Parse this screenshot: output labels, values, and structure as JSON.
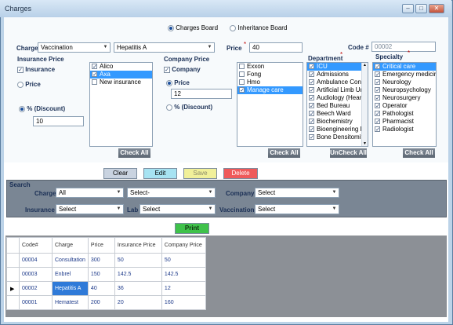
{
  "window": {
    "title": "Charges",
    "min": "–",
    "max": "□",
    "close": "✕"
  },
  "board": {
    "charges": "Charges Board",
    "inheritance": "Inheritance Board"
  },
  "charge_row": {
    "charge_label": "Charge",
    "charge_value": "Vaccination",
    "sub_value": "Hepatitis A",
    "price_label": "Price",
    "price_value": "40",
    "code_label": "Code #",
    "code_value": "00002"
  },
  "insurance_price": {
    "title": "Insurance Price",
    "insurance": "Insurance",
    "price": "Price",
    "discount": "% (Discount)",
    "discount_value": "10",
    "items": [
      "Alico",
      "Axa",
      "New insurance"
    ],
    "check_all": "Check All"
  },
  "company_price": {
    "title": "Company Price",
    "company": "Company",
    "price": "Price",
    "price_value": "12",
    "discount": "% (Discount)",
    "items": [
      "Exxon",
      "Fong",
      "Hmo",
      "Manage care"
    ],
    "check_all": "Check All"
  },
  "department": {
    "title": "Department",
    "items": [
      "ICU",
      "Admissions",
      "Ambulance Contr",
      "Artificial Limb Ur",
      "Audiology (Heari",
      "Bed Bureau",
      "Beech Ward",
      "Biochemistry",
      "Bioengineering D",
      "Bone Densitomit"
    ],
    "uncheck_all": "UnCheck All"
  },
  "specialty": {
    "title": "Specialty",
    "items": [
      "Critical care",
      "Emergency medicin",
      "Neurology",
      "Neuropsychology",
      "Neurosurgery",
      "Operator",
      "Pathologist",
      "Pharmacist",
      "Radiologist"
    ],
    "check_all": "Check All"
  },
  "actions": {
    "clear": "Clear",
    "edit": "Edit",
    "save": "Save",
    "delete": "Delete"
  },
  "search": {
    "title": "Search",
    "charge_label": "Charge",
    "charge_value": "All",
    "sub_value": "Select-",
    "company_label": "Company",
    "company_value": "Select",
    "insurance_label": "Insurance",
    "insurance_value": "Select",
    "lab_label": "Lab",
    "lab_value": "Select",
    "vaccination_label": "Vaccination",
    "vaccination_value": "Select"
  },
  "print": "Print",
  "grid": {
    "headers": [
      "Code#",
      "Charge",
      "Price",
      "Insurance Price",
      "Company Price"
    ],
    "rows": [
      [
        "00004",
        "Consultation",
        "300",
        "50",
        "50"
      ],
      [
        "00003",
        "Enbrel",
        "150",
        "142.5",
        "142.5"
      ],
      [
        "00002",
        "Hepatitis A",
        "40",
        "36",
        "12"
      ],
      [
        "00001",
        "Hematest",
        "200",
        "20",
        "160"
      ]
    ],
    "current_marker": "▶"
  },
  "colors": {
    "selection": "#3399ff",
    "clear_btn": "#c9d3e0",
    "edit_btn": "#a7e3f2",
    "save_btn": "#f1f09a",
    "delete_btn": "#ef5a5a",
    "print_btn": "#3fc24a"
  }
}
